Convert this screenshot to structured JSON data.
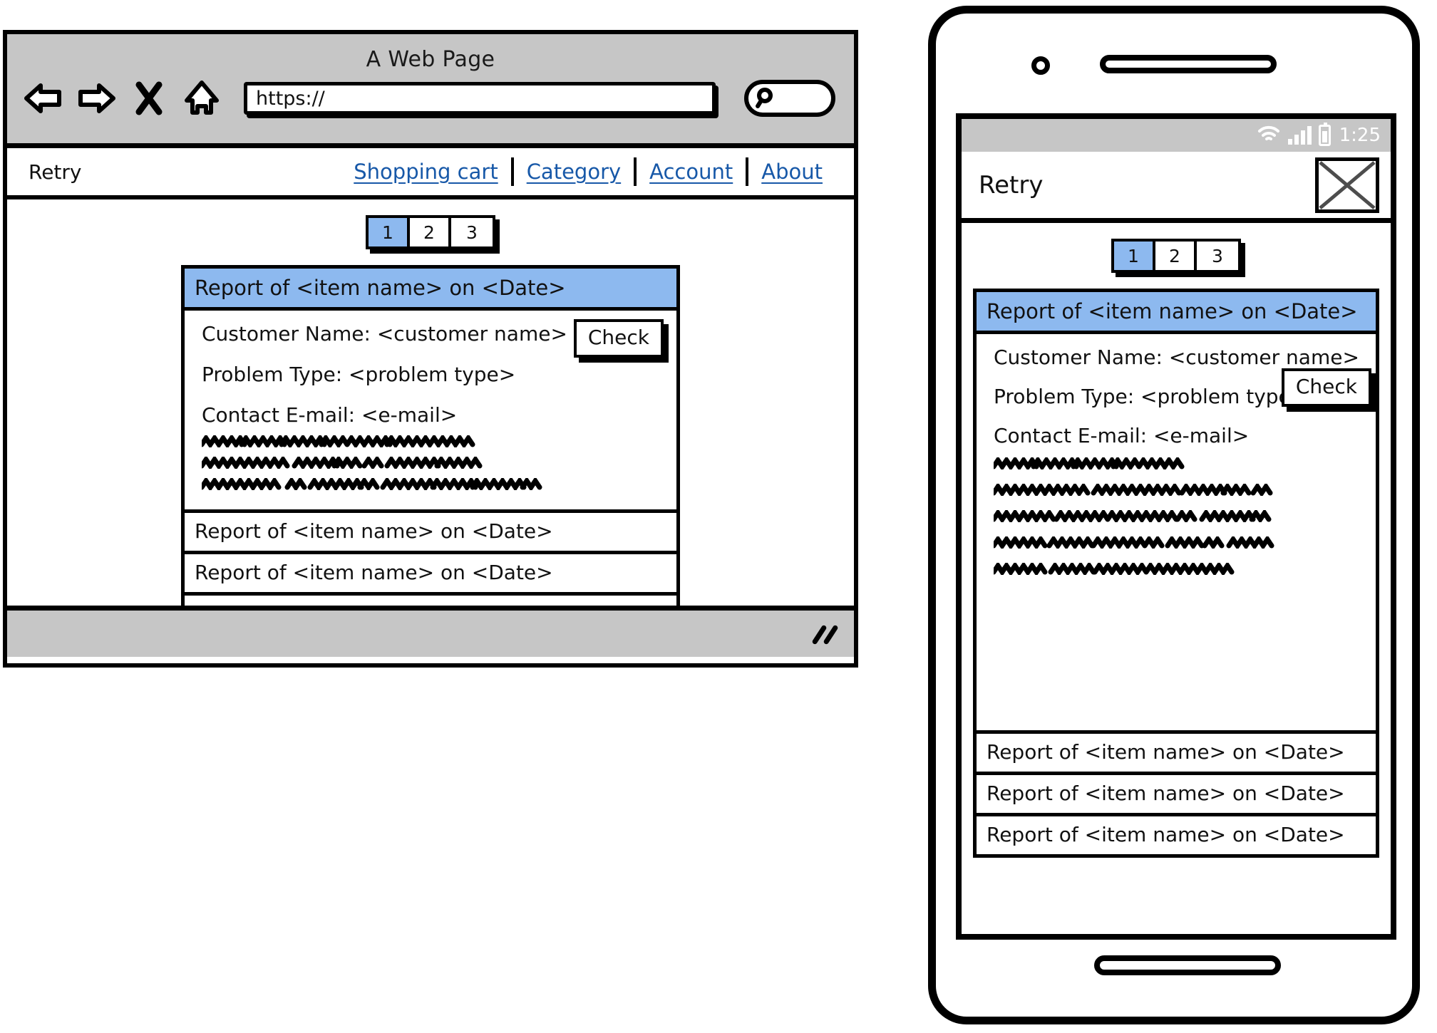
{
  "browser": {
    "window_title": "A Web Page",
    "url_value": "https://",
    "toolbar_icons": {
      "back": "back-arrow-icon",
      "forward": "forward-arrow-icon",
      "stop": "close-x-icon",
      "home": "home-icon",
      "search": "search-icon"
    }
  },
  "site_nav": {
    "brand": "Retry",
    "links": [
      {
        "label": "Shopping cart"
      },
      {
        "label": "Category"
      },
      {
        "label": "Account"
      },
      {
        "label": "About"
      }
    ]
  },
  "pagination": {
    "pages": [
      {
        "label": "1",
        "active": true
      },
      {
        "label": "2",
        "active": false
      },
      {
        "label": "3",
        "active": false
      }
    ],
    "selected": "1",
    "active_color": "#8db9ef"
  },
  "report": {
    "header": "Report of <item name> on <Date>",
    "fields": [
      "Customer Name: <customer name>",
      "Problem Type: <problem type>",
      "Contact E-mail: <e-mail>"
    ],
    "check_button": "Check",
    "desktop_scribble_lines": 3,
    "mobile_scribble_lines": 5
  },
  "report_rows": [
    {
      "label": "Report of <item name> on <Date>"
    },
    {
      "label": "Report of <item name> on <Date>"
    },
    {
      "label": "Report of <item name> on <Date>"
    }
  ],
  "phone": {
    "status_bar": {
      "time": "1:25",
      "icons": [
        "wifi-icon",
        "cellular-signal-icon",
        "battery-icon"
      ]
    },
    "app_bar": {
      "title": "Retry",
      "right_icon": "image-placeholder-icon"
    }
  }
}
